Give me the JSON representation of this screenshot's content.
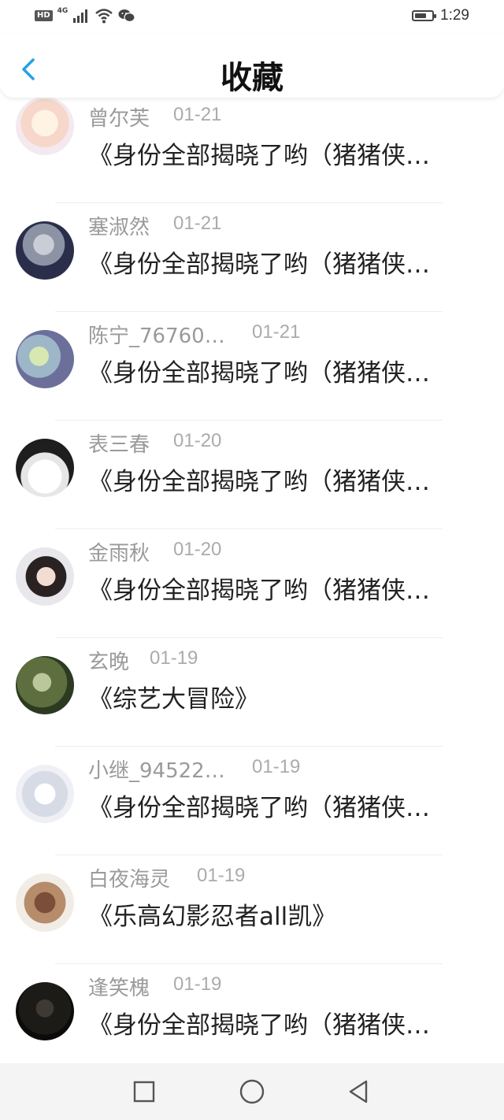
{
  "status_bar": {
    "network_badge": "HD",
    "network_type": "4G",
    "time": "1:29",
    "battery_level": 0.7
  },
  "header": {
    "title": "收藏"
  },
  "items": [
    {
      "name": "曾尔芙",
      "date": "01-21",
      "content": "《身份全部揭晓了哟（猪猪侠…"
    },
    {
      "name": "塞淑然",
      "date": "01-21",
      "content": "《身份全部揭晓了哟（猪猪侠…"
    },
    {
      "name": "陈宁_76760…",
      "date": "01-21",
      "content": "《身份全部揭晓了哟（猪猪侠…"
    },
    {
      "name": "表三春",
      "date": "01-20",
      "content": "《身份全部揭晓了哟（猪猪侠…"
    },
    {
      "name": "金雨秋",
      "date": "01-20",
      "content": "《身份全部揭晓了哟（猪猪侠…"
    },
    {
      "name": "玄晚",
      "date": "01-19",
      "content": "《综艺大冒险》"
    },
    {
      "name": "小继_94522…",
      "date": "01-19",
      "content": "《身份全部揭晓了哟（猪猪侠…"
    },
    {
      "name": "白夜海灵",
      "date": "01-19",
      "content": "《乐高幻影忍者all凯》"
    },
    {
      "name": "逢笑槐",
      "date": "01-19",
      "content": "《身份全部揭晓了哟（猪猪侠…"
    }
  ],
  "colors": {
    "accent": "#2a9fe6",
    "name_text": "#9a9a9a",
    "content_text": "#222222"
  },
  "icons": {
    "back": "back-arrow-icon",
    "recent": "square-icon",
    "home": "circle-icon",
    "nav_back": "triangle-back-icon"
  }
}
